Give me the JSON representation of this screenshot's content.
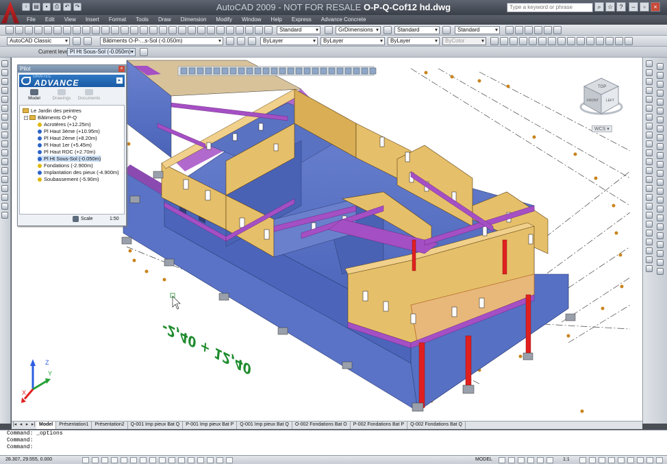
{
  "window": {
    "app_name": "AutoCAD 2009 - NOT FOR RESALE",
    "file_name": "O-P-Q-Cof12 hd.dwg",
    "help_search_placeholder": "Type a keyword or phrase"
  },
  "menu": [
    "File",
    "Edit",
    "View",
    "Insert",
    "Format",
    "Tools",
    "Draw",
    "Dimension",
    "Modify",
    "Window",
    "Help",
    "Express",
    "Advance Concrete"
  ],
  "styles_toolbar": {
    "text_style": "Standard",
    "dim_style": "GrDimensions",
    "table_style": "Standard",
    "multileader_style": "Standard"
  },
  "layers_toolbar": {
    "workspace": "AutoCAD Classic",
    "layer": "Bâtiments O-P-...s-Sol (-0.050m)",
    "color": "ByLayer",
    "linetype": "ByLayer",
    "lineweight": "ByLayer",
    "plotstyle": "ByColor"
  },
  "level_toolbar": {
    "label": "Current level:",
    "value": "Pl Ht Sous-Sol (-0.050m)"
  },
  "pilot": {
    "title": "Pilot",
    "brand": "GRAITEC",
    "product": "ADVANCE",
    "tabs": [
      "Model",
      "Drawings",
      "Documents"
    ],
    "tree": {
      "root": "Le Jardin des peintres",
      "group": "Bâtiments O-P-Q",
      "levels": [
        {
          "label": "Acrotères (+12.25m)",
          "color": "#e0b600"
        },
        {
          "label": "Pl Haut 3ème (+10.95m)",
          "color": "#2a63c8"
        },
        {
          "label": "Pl Haut 2ème (+8.20m)",
          "color": "#2a63c8"
        },
        {
          "label": "Pl Haut 1er (+5.45m)",
          "color": "#2a63c8"
        },
        {
          "label": "Pl Haut RDC (+2.70m)",
          "color": "#2a63c8"
        },
        {
          "label": "Pl Ht Sous-Sol (-0.050m)",
          "color": "#2a63c8"
        },
        {
          "label": "Fondations (-2.900m)",
          "color": "#e0b600"
        },
        {
          "label": "Implantation des pieux (-4.900m)",
          "color": "#2a63c8"
        },
        {
          "label": "Soubassement (-5.90m)",
          "color": "#e0b600"
        }
      ]
    },
    "scale_label": "Scale",
    "scale_value": "1:50"
  },
  "viewcube": {
    "top": "TOP",
    "front": "FRONT",
    "left": "LEFT",
    "wcs": "WCS"
  },
  "ucs": {
    "z": "Z",
    "y": "Y",
    "x": "X"
  },
  "level_text": "-2,40 + 12,40",
  "layout_tabs": [
    "Model",
    "Présentation1",
    "Présentation2",
    "Q-001 Imp pieux Bat Q",
    "P-001 Imp pieux Bat P",
    "Q-001 Imp pieux Bat Q",
    "O-002 Fondations Bat O",
    "P-002 Fondations Bat P",
    "Q-002 Fondations Bat Q"
  ],
  "command_lines": [
    "Command: _options",
    "Command:",
    "Command:"
  ],
  "status": {
    "coords": "28.307, 29.555, 0.000",
    "model": "MODEL",
    "scale": "1:1"
  },
  "colors": {
    "concrete_blue": "#5a73c6",
    "wall_yellow": "#e6bf6a",
    "beam_magenta": "#a54fc4",
    "column_red": "#e02020",
    "footing_grey": "#9aa0ab"
  }
}
